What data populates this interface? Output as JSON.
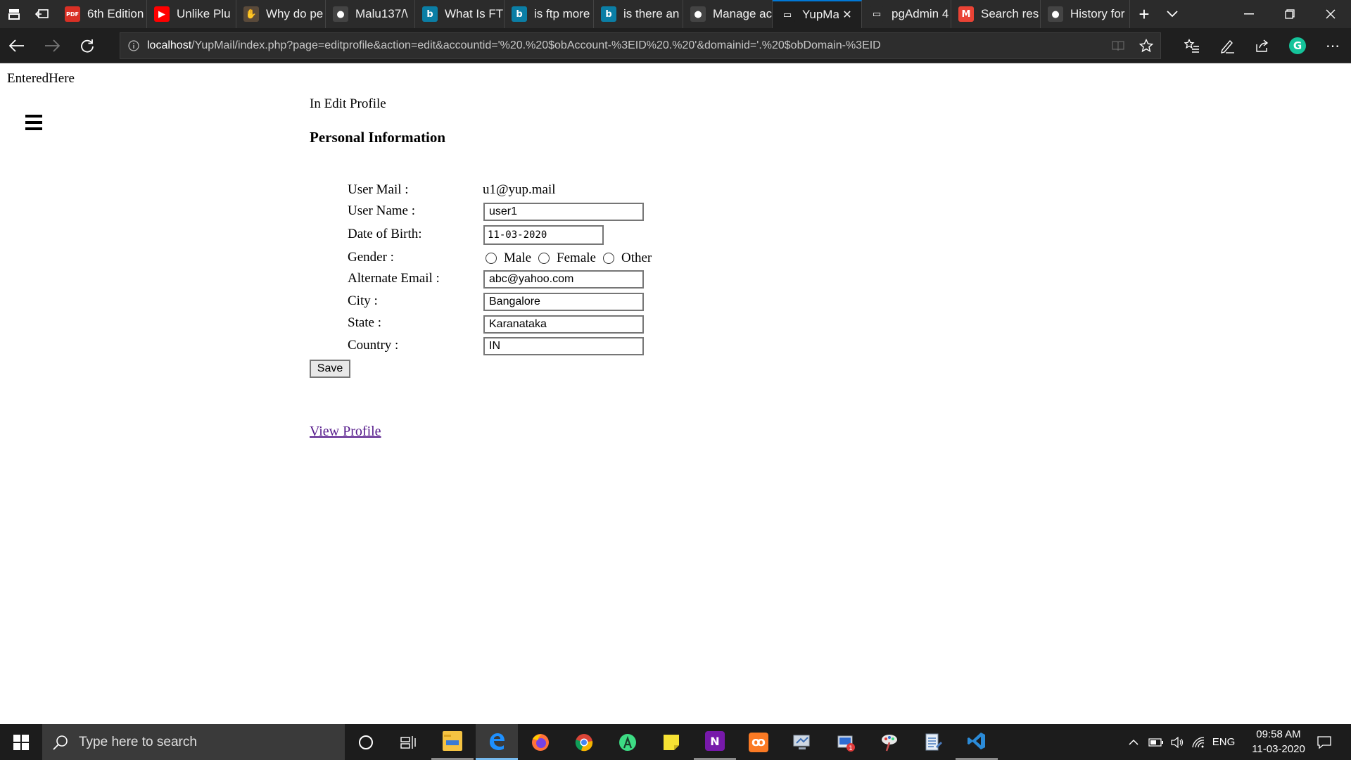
{
  "browser": {
    "tabs": [
      {
        "title": "6th Edition",
        "icon": "pdf-icon",
        "color": "#d93025",
        "glyph": "PDF"
      },
      {
        "title": "Unlike Plu",
        "icon": "youtube-icon",
        "color": "#ff0000",
        "glyph": "▶"
      },
      {
        "title": "Why do pe",
        "icon": "hand-icon",
        "color": "#5a4a3a",
        "glyph": "✋"
      },
      {
        "title": "Malu137/\\",
        "icon": "github-icon",
        "color": "#444444",
        "glyph": "●"
      },
      {
        "title": "What Is FT",
        "icon": "bing-icon",
        "color": "#0b7ea5",
        "glyph": "b"
      },
      {
        "title": "is ftp more",
        "icon": "bing-icon",
        "color": "#0b7ea5",
        "glyph": "b"
      },
      {
        "title": "is there an",
        "icon": "bing-icon",
        "color": "#0b7ea5",
        "glyph": "b"
      },
      {
        "title": "Manage ac",
        "icon": "github-icon",
        "color": "#444444",
        "glyph": "●"
      },
      {
        "title": "YupMa",
        "icon": "page-icon",
        "color": "#1f1f1f",
        "glyph": "▭",
        "active": true
      },
      {
        "title": "pgAdmin 4",
        "icon": "page-icon",
        "color": "#2b2b2b",
        "glyph": "▭"
      },
      {
        "title": "Search res",
        "icon": "gmail-icon",
        "color": "#ea4335",
        "glyph": "M"
      },
      {
        "title": "History for",
        "icon": "github-icon",
        "color": "#444444",
        "glyph": "●"
      }
    ],
    "url_host": "localhost",
    "url_rest": "/YupMail/index.php?page=editprofile&action=edit&accountid='%20.%20$obAccount-%3EID%20.%20'&domainid='.%20$obDomain-%3EID",
    "grammarly_glyph": "G"
  },
  "page": {
    "top_text": "EnteredHere",
    "heading": "In Edit Profile",
    "section_title": "Personal Information",
    "labels": {
      "user_mail": "User Mail :",
      "user_name": "User Name :",
      "dob": "Date of Birth:",
      "gender": "Gender :",
      "alt_email": "Alternate Email :",
      "city": "City :",
      "state": "State :",
      "country": "Country :"
    },
    "values": {
      "user_mail": "u1@yup.mail",
      "user_name": "user1",
      "dob": "11-03-2020",
      "alt_email": "abc@yahoo.com",
      "city": "Bangalore",
      "state": "Karanataka",
      "country": "IN"
    },
    "gender_options": [
      "Male",
      "Female",
      "Other"
    ],
    "save_label": "Save",
    "view_profile_link": "View Profile",
    "link_color": "#551a8b"
  },
  "taskbar": {
    "search_placeholder": "Type here to search",
    "language": "ENG",
    "time": "09:58 AM",
    "date": "11-03-2020",
    "notification_badge": "1"
  }
}
